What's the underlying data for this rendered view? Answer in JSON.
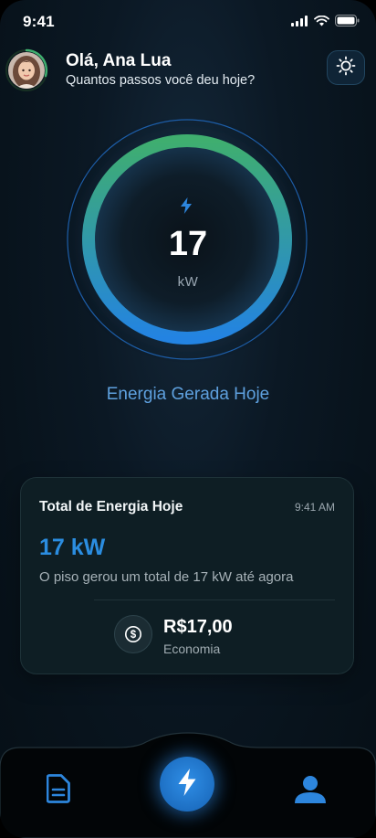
{
  "status_bar": {
    "time": "9:41",
    "icons": [
      "signal-icon",
      "wifi-icon",
      "battery-icon"
    ]
  },
  "header": {
    "greeting": "Olá, Ana Lua",
    "subtitle": "Quantos passos você deu hoje?",
    "theme_toggle_icon": "sun-icon"
  },
  "gauge": {
    "icon": "lightning-icon",
    "value": "17",
    "unit": "kW",
    "caption": "Energia Gerada Hoje",
    "colors": {
      "start": "#3fae6f",
      "end": "#2383e2"
    }
  },
  "energy_card": {
    "title": "Total de Energia Hoje",
    "time": "9:41 AM",
    "value": "17 kW",
    "description": "O piso gerou um total de 17 kW até agora",
    "savings_icon": "dollar-coin-icon",
    "savings_value": "R$17,00",
    "savings_label": "Economia"
  },
  "bottom_nav": {
    "items": [
      {
        "icon": "document-icon"
      },
      {
        "icon": "lightning-icon"
      },
      {
        "icon": "user-icon"
      }
    ],
    "accent_color": "#2d86dd"
  }
}
